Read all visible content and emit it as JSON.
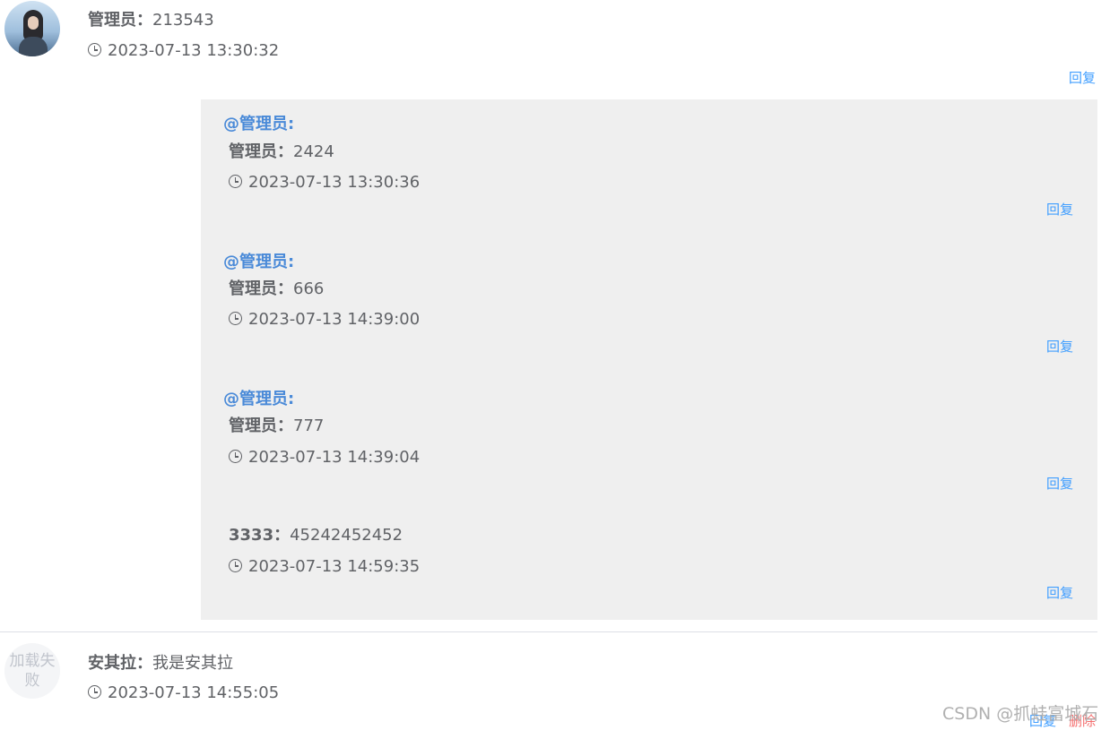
{
  "top_comment": {
    "name": "管理员：",
    "content": "213543",
    "time": "2023-07-13 13:30:32",
    "reply_label": "回复"
  },
  "replies": [
    {
      "at": "@管理员:",
      "name": "管理员：",
      "content": "2424",
      "time": "2023-07-13 13:30:36",
      "reply_label": "回复"
    },
    {
      "at": "@管理员:",
      "name": "管理员：",
      "content": "666",
      "time": "2023-07-13 14:39:00",
      "reply_label": "回复"
    },
    {
      "at": "@管理员:",
      "name": "管理员：",
      "content": "777",
      "time": "2023-07-13 14:39:04",
      "reply_label": "回复"
    },
    {
      "name": "3333：",
      "content": "45242452452",
      "time": "2023-07-13 14:59:35",
      "reply_label": "回复"
    }
  ],
  "second_comment": {
    "avatar_text": "加载失败",
    "name": "安其拉：",
    "content": "我是安其拉",
    "time": "2023-07-13 14:55:05",
    "reply_label": "回复",
    "delete_label": "删除"
  },
  "watermark": "CSDN @抓蛙富城石",
  "colors": {
    "link": "#409eff",
    "at_mention": "#4a8ad8",
    "delete": "#f56c6c",
    "panel_bg": "#efefef"
  }
}
